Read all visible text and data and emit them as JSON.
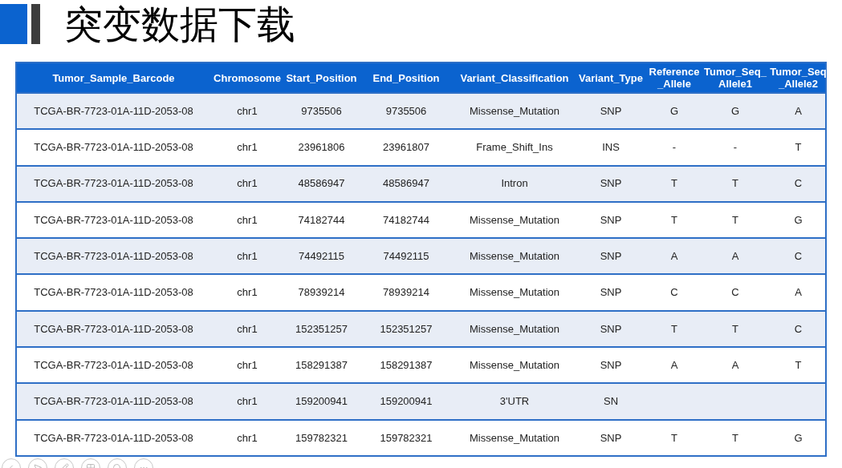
{
  "slide": {
    "title": "突变数据下载"
  },
  "table": {
    "columns": [
      "Tumor_Sample_Barcode",
      "Chromosome",
      "Start_Position",
      "End_Position",
      "Variant_Classification",
      "Variant_Type",
      "Reference_Allele",
      "Tumor_Seq_Allele1",
      "Tumor_Seq_Allele2"
    ],
    "rows": [
      [
        "TCGA-BR-7723-01A-11D-2053-08",
        "chr1",
        "9735506",
        "9735506",
        "Missense_Mutation",
        "SNP",
        "G",
        "G",
        "A"
      ],
      [
        "TCGA-BR-7723-01A-11D-2053-08",
        "chr1",
        "23961806",
        "23961807",
        "Frame_Shift_Ins",
        "INS",
        "-",
        "-",
        "T"
      ],
      [
        "TCGA-BR-7723-01A-11D-2053-08",
        "chr1",
        "48586947",
        "48586947",
        "Intron",
        "SNP",
        "T",
        "T",
        "C"
      ],
      [
        "TCGA-BR-7723-01A-11D-2053-08",
        "chr1",
        "74182744",
        "74182744",
        "Missense_Mutation",
        "SNP",
        "T",
        "T",
        "G"
      ],
      [
        "TCGA-BR-7723-01A-11D-2053-08",
        "chr1",
        "74492115",
        "74492115",
        "Missense_Mutation",
        "SNP",
        "A",
        "A",
        "C"
      ],
      [
        "TCGA-BR-7723-01A-11D-2053-08",
        "chr1",
        "78939214",
        "78939214",
        "Missense_Mutation",
        "SNP",
        "C",
        "C",
        "A"
      ],
      [
        "TCGA-BR-7723-01A-11D-2053-08",
        "chr1",
        "152351257",
        "152351257",
        "Missense_Mutation",
        "SNP",
        "T",
        "T",
        "C"
      ],
      [
        "TCGA-BR-7723-01A-11D-2053-08",
        "chr1",
        "158291387",
        "158291387",
        "Missense_Mutation",
        "SNP",
        "A",
        "A",
        "T"
      ],
      [
        "TCGA-BR-7723-01A-11D-2053-08",
        "chr1",
        "159200941",
        "159200941",
        "3'UTR",
        "SN"
      ],
      [
        "TCGA-BR-7723-01A-11D-2053-08",
        "chr1",
        "159782321",
        "159782321",
        "Missense_Mutation",
        "SNP",
        "T",
        "T",
        "G"
      ]
    ]
  }
}
